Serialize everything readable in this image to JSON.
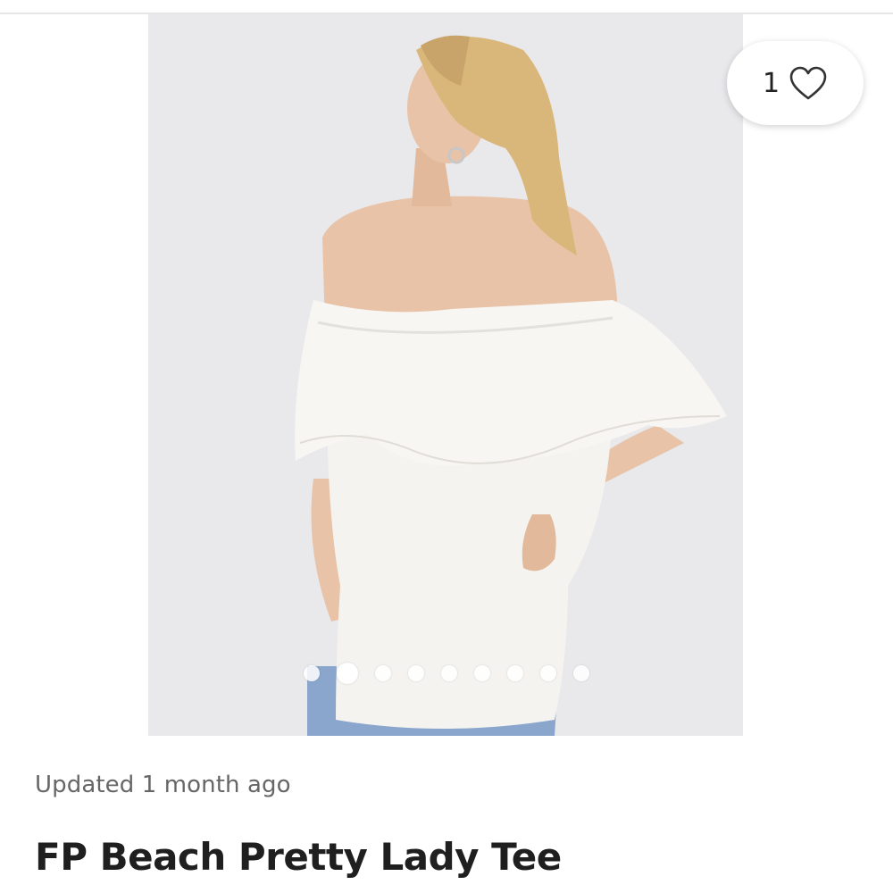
{
  "listing": {
    "image_alt": "",
    "like_count": "1",
    "updated_text": "Updated 1 month ago",
    "title": "FP Beach Pretty Lady Tee",
    "carousel": {
      "total": 9,
      "active_index": 1
    }
  },
  "colors": {
    "photo_background": "#e9e9ec",
    "shirt": "#f7f6f3",
    "hair": "#d9b77a",
    "skin": "#e8c3a8",
    "jeans": "#8aa6cc"
  },
  "icons": {
    "like": "heart-icon"
  }
}
